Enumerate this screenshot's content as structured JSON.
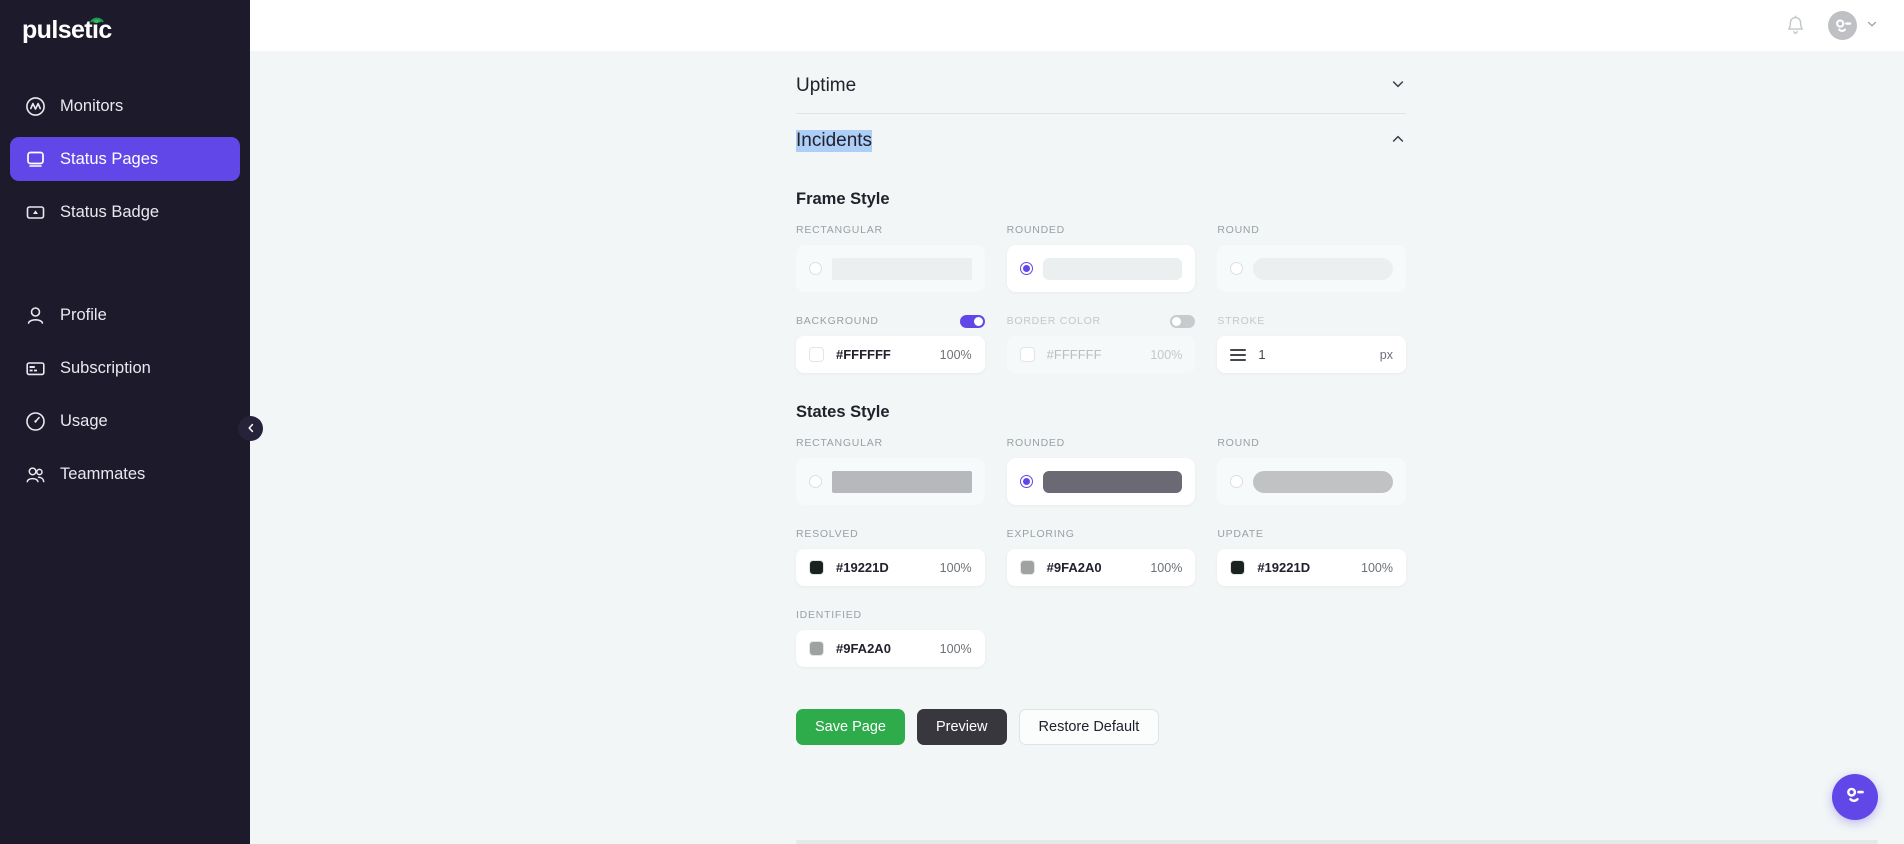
{
  "brand": {
    "name": "pulsetic",
    "accent": "#6247e8"
  },
  "sidebar": {
    "items": [
      {
        "label": "Monitors",
        "icon": "monitor-gauge-icon",
        "active": false
      },
      {
        "label": "Status Pages",
        "icon": "status-page-icon",
        "active": true
      },
      {
        "label": "Status Badge",
        "icon": "status-badge-icon",
        "active": false
      },
      {
        "label": "Profile",
        "icon": "user-icon",
        "active": false
      },
      {
        "label": "Subscription",
        "icon": "card-icon",
        "active": false
      },
      {
        "label": "Usage",
        "icon": "speedometer-icon",
        "active": false
      },
      {
        "label": "Teammates",
        "icon": "users-icon",
        "active": false
      }
    ],
    "collapse_icon": "chevron-left-icon"
  },
  "topbar": {
    "bell_icon": "bell-icon",
    "avatar_icon": "avatar-face-icon",
    "chevron_icon": "chevron-down-icon"
  },
  "sections": [
    {
      "title": "Uptime",
      "expanded": false,
      "chevron": "chevron-down-icon"
    },
    {
      "title": "Incidents",
      "expanded": true,
      "chevron": "chevron-up-icon",
      "selected": true
    }
  ],
  "frame_style": {
    "heading": "Frame Style",
    "options": [
      {
        "label": "RECTANGULAR",
        "selected": false,
        "shape": "rect"
      },
      {
        "label": "ROUNDED",
        "selected": true,
        "shape": "rounded"
      },
      {
        "label": "ROUND",
        "selected": false,
        "shape": "round"
      }
    ],
    "background": {
      "label": "BACKGROUND",
      "enabled": true,
      "hex": "#FFFFFF",
      "opacity": "100%"
    },
    "border_color": {
      "label": "BORDER COLOR",
      "enabled": false,
      "hex": "#FFFFFF",
      "opacity": "100%"
    },
    "stroke": {
      "label": "STROKE",
      "value": "1",
      "unit": "px",
      "icon": "stroke-lines-icon"
    }
  },
  "states_style": {
    "heading": "States Style",
    "options": [
      {
        "label": "RECTANGULAR",
        "selected": false,
        "shape": "rect"
      },
      {
        "label": "ROUNDED",
        "selected": true,
        "shape": "rounded"
      },
      {
        "label": "ROUND",
        "selected": false,
        "shape": "round"
      }
    ],
    "colors": [
      {
        "label": "RESOLVED",
        "hex": "#19221D",
        "opacity": "100%"
      },
      {
        "label": "EXPLORING",
        "hex": "#9FA2A0",
        "opacity": "100%"
      },
      {
        "label": "UPDATE",
        "hex": "#19221D",
        "opacity": "100%"
      },
      {
        "label": "IDENTIFIED",
        "hex": "#9FA2A0",
        "opacity": "100%"
      }
    ]
  },
  "actions": {
    "save": "Save Page",
    "preview": "Preview",
    "restore": "Restore Default"
  },
  "chat": {
    "icon": "chat-face-icon"
  }
}
